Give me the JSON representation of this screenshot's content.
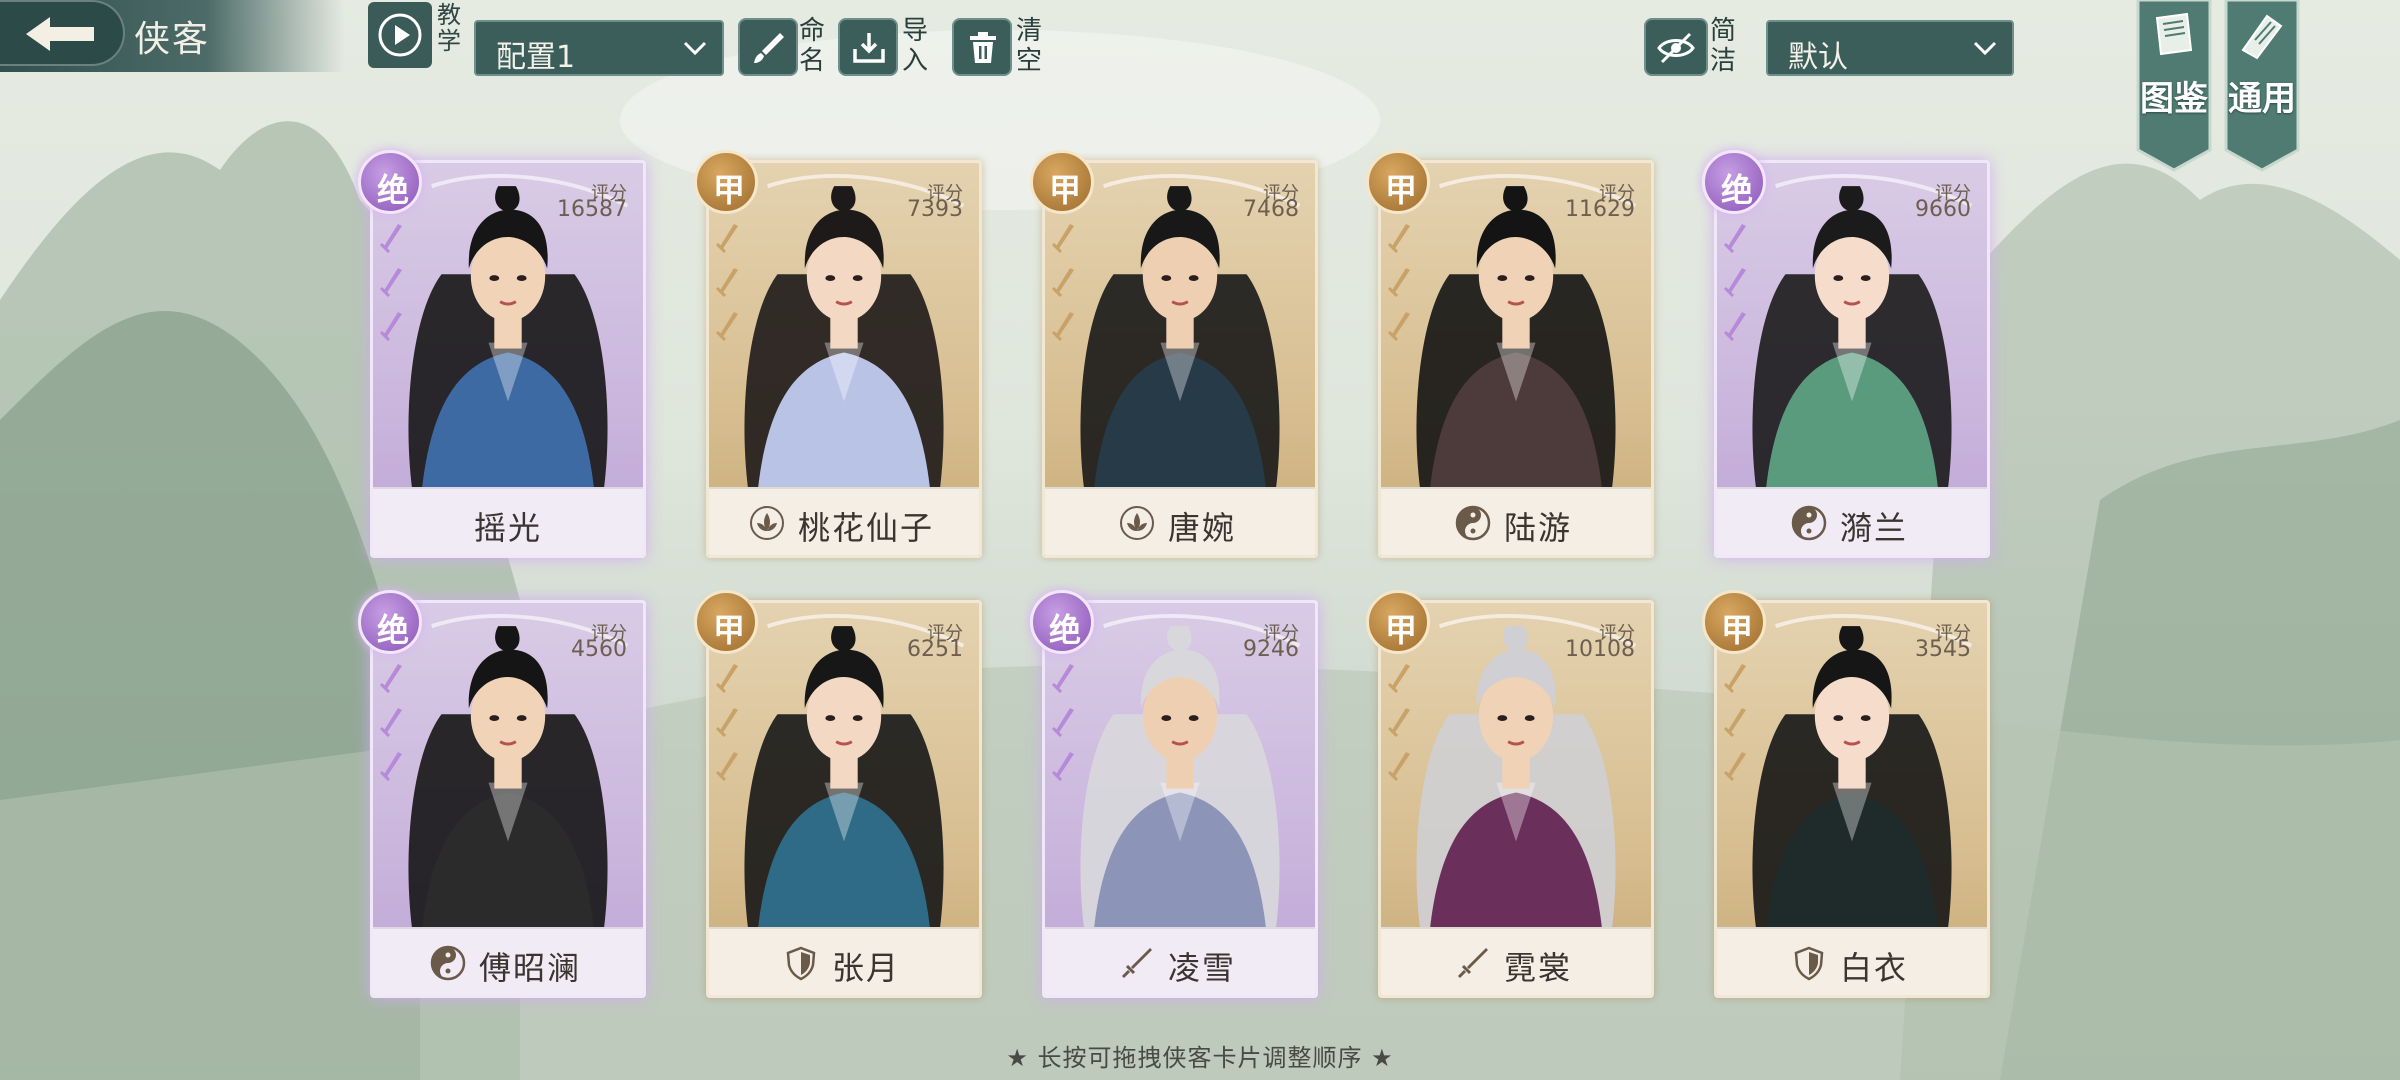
{
  "header": {
    "title": "侠客",
    "teach_label": "教学",
    "config_select": "配置1",
    "rename_label": "命名",
    "import_label": "导入",
    "clear_label": "清空",
    "concise_label": "简洁",
    "sort_select": "默认",
    "banner_left": "图鉴",
    "banner_right": "通用"
  },
  "score_label": "评分",
  "cards": [
    {
      "name": "摇光",
      "score": "16587",
      "rank": "绝",
      "cls": "none"
    },
    {
      "name": "桃花仙子",
      "score": "7393",
      "rank": "甲",
      "cls": "lotus-icon"
    },
    {
      "name": "唐婉",
      "score": "7468",
      "rank": "甲",
      "cls": "lotus-icon"
    },
    {
      "name": "陆游",
      "score": "11629",
      "rank": "甲",
      "cls": "taiji-icon"
    },
    {
      "name": "漪兰",
      "score": "9660",
      "rank": "绝",
      "cls": "taiji-icon"
    },
    {
      "name": "傅昭澜",
      "score": "4560",
      "rank": "绝",
      "cls": "taiji-icon"
    },
    {
      "name": "张月",
      "score": "6251",
      "rank": "甲",
      "cls": "shield-icon"
    },
    {
      "name": "凌雪",
      "score": "9246",
      "rank": "绝",
      "cls": "sword-icon"
    },
    {
      "name": "霓裳",
      "score": "10108",
      "rank": "甲",
      "cls": "sword-icon"
    },
    {
      "name": "白衣",
      "score": "3545",
      "rank": "甲",
      "cls": "shield-icon"
    }
  ],
  "hint": "★ 长按可拖拽侠客卡片调整顺序 ★",
  "colors": {
    "jue": "#8a55b6",
    "jia": "#9e6b2c",
    "toolbar": "#3b5e5b"
  }
}
